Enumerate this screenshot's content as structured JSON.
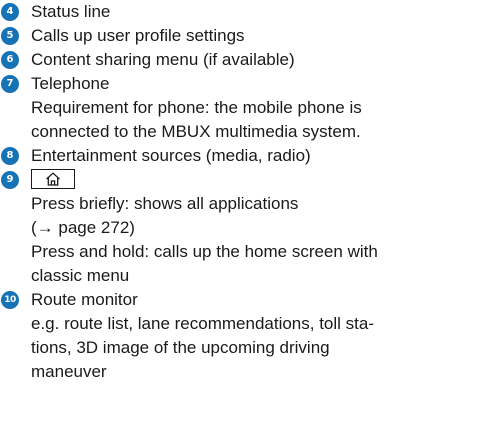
{
  "items": [
    {
      "number": "4",
      "title": "Status line",
      "details": []
    },
    {
      "number": "5",
      "title": "Calls up user profile settings",
      "details": []
    },
    {
      "number": "6",
      "title": "Content sharing menu (if available)",
      "details": []
    },
    {
      "number": "7",
      "title": "Telephone",
      "details": [
        "Requirement for phone: the mobile phone is",
        "connected to the MBUX multimedia system."
      ]
    },
    {
      "number": "8",
      "title": "Entertainment sources (media, radio)",
      "details": []
    },
    {
      "number": "9",
      "title_icon": "home-key-icon",
      "details": [
        "Press briefly: shows all applications",
        "(→ page 272)",
        "Press and hold: calls up the home screen with",
        "classic menu"
      ]
    },
    {
      "number": "10",
      "title": "Route monitor",
      "details": [
        "e.g. route list, lane recommendations, toll sta-",
        "tions, 3D image of the upcoming driving",
        "maneuver"
      ]
    }
  ],
  "colors": {
    "badge": "#1573b6",
    "text": "#1a1a1a"
  }
}
